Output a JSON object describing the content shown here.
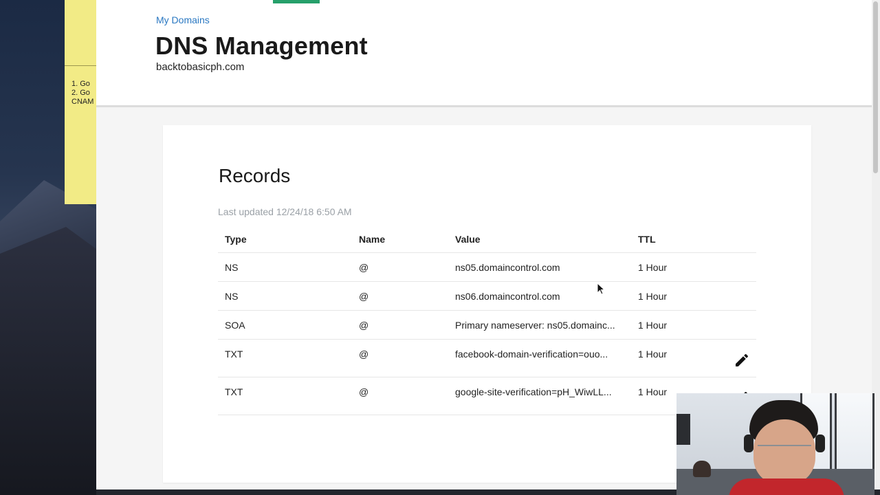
{
  "desktop": {
    "sticky_note": "1. Go\n2. Go\nCNAM"
  },
  "header": {
    "breadcrumb": "My Domains",
    "title": "DNS Management",
    "domain": "backtobasicph.com"
  },
  "records": {
    "title": "Records",
    "last_updated": "Last updated 12/24/18 6:50 AM",
    "columns": [
      "Type",
      "Name",
      "Value",
      "TTL"
    ],
    "rows": [
      {
        "type": "NS",
        "name": "@",
        "value": "ns05.domaincontrol.com",
        "ttl": "1 Hour",
        "editable": false
      },
      {
        "type": "NS",
        "name": "@",
        "value": "ns06.domaincontrol.com",
        "ttl": "1 Hour",
        "editable": false
      },
      {
        "type": "SOA",
        "name": "@",
        "value": "Primary nameserver: ns05.domainc...",
        "ttl": "1 Hour",
        "editable": false
      },
      {
        "type": "TXT",
        "name": "@",
        "value": "facebook-domain-verification=ouo...",
        "ttl": "1 Hour",
        "editable": true
      },
      {
        "type": "TXT",
        "name": "@",
        "value": "google-site-verification=pH_WiwLL...",
        "ttl": "1 Hour",
        "editable": true
      }
    ]
  },
  "icons": {
    "edit": "pencil-icon",
    "cursor": "mouse-pointer-icon"
  },
  "colors": {
    "link": "#2a78c2",
    "active_tab": "#26a06b",
    "muted_text": "#9aa0a6",
    "sticky_note": "#f2eb86"
  }
}
